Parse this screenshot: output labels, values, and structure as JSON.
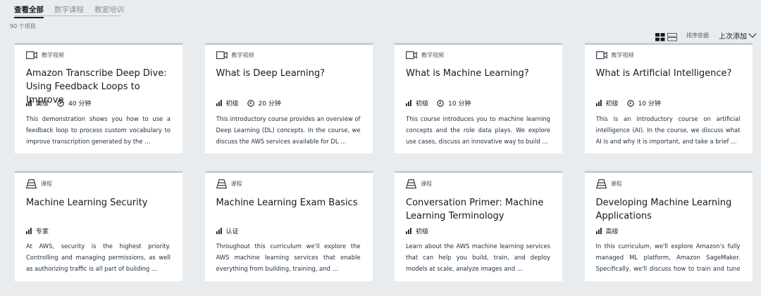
{
  "tabs": [
    {
      "label": "查看全部",
      "active": true
    },
    {
      "label": "数字课程",
      "active": false
    },
    {
      "label": "教室培训",
      "active": false
    }
  ],
  "result_count": "90 个项目",
  "toolbar": {
    "grid_view_icon": "grid-view-icon",
    "list_view_icon": "list-view-icon",
    "sort_label": "排序依据",
    "sort_value": "上次添加"
  },
  "cards": [
    {
      "type": "教学视频",
      "type_icon": "video-icon",
      "title": "Amazon Transcribe Deep Dive: Using Feedback Loops to Improve",
      "level": "高级",
      "duration": "40 分钟",
      "description": "This demonstration shows you how to use a feedback loop to process custom vocabulary to improve transcription generated by the …"
    },
    {
      "type": "教学视频",
      "type_icon": "video-icon",
      "title": "What is Deep Learning?",
      "level": "初级",
      "duration": "20 分钟",
      "description": "This introductory course provides an overview of Deep Learning (DL) concepts. In the course, we discuss the AWS services available for DL …"
    },
    {
      "type": "教学视频",
      "type_icon": "video-icon",
      "title": "What is Machine Learning?",
      "level": "初级",
      "duration": "10 分钟",
      "description": "This course introduces you to machine learning concepts and the role data plays. We explore use cases, discuss an innovative way to build …"
    },
    {
      "type": "教学视频",
      "type_icon": "video-icon",
      "title": "What is Artificial Intelligence?",
      "level": "初级",
      "duration": "10 分钟",
      "description": "This is an introductory course on artificial intelligence (AI). In the course, we discuss what AI is and why it is important, and take a brief …"
    },
    {
      "type": "课程",
      "type_icon": "curriculum-icon",
      "title": "Machine Learning Security",
      "level": "专家",
      "duration": "",
      "description": "At AWS, security is the highest priority. Controlling and managing permissions, as well as authorizing traffic is all part of building …"
    },
    {
      "type": "课程",
      "type_icon": "curriculum-icon",
      "title": "Machine Learning Exam Basics",
      "level": "认证",
      "duration": "",
      "description": "Throughout this curriculum we'll explore the AWS machine learning services that enable everything from building, training, and …"
    },
    {
      "type": "课程",
      "type_icon": "curriculum-icon",
      "title": "Conversation Primer: Machine Learning Terminology",
      "level": "初级",
      "duration": "",
      "description": "Learn about the AWS machine learning services that can help you build, train, and deploy models at scale, analyze images and …"
    },
    {
      "type": "课程",
      "type_icon": "curriculum-icon",
      "title": "Developing Machine Learning Applications",
      "level": "高级",
      "duration": "",
      "description": "In this curriculum, we'll explore Amazon's fully managed ML platform, Amazon SageMaker. Specifically, we'll discuss how to train and tune …"
    }
  ],
  "colors": {
    "background": "#e9ecef",
    "card": "#ffffff",
    "text": "#16191f",
    "muted": "#545b64"
  }
}
